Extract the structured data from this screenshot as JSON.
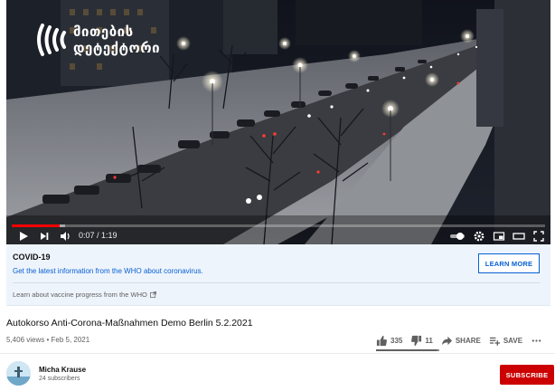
{
  "player": {
    "logo_line1": "მითების",
    "logo_line2": "დეტექტორი",
    "time_display": "0:07 / 1:19",
    "progress_fraction": 0.089,
    "buffer_fraction": 0.1
  },
  "covid": {
    "title": "COVID-19",
    "description": "Get the latest information from the WHO about coronavirus.",
    "vaccine_link": "Learn about vaccine progress from the WHO",
    "learn_more": "LEARN MORE"
  },
  "video": {
    "title": "Autokorso Anti-Corona-Maßnahmen Demo Berlin 5.2.2021",
    "views_date": "5,406 views • Feb 5, 2021",
    "likes": "335",
    "dislikes": "11",
    "share_label": "SHARE",
    "save_label": "SAVE",
    "like_fraction": 0.968
  },
  "channel": {
    "name": "Micha Krause",
    "subscribers": "24 subscribers",
    "subscribe_label": "SUBSCRIBE"
  },
  "colors": {
    "accent_red": "#cc0000",
    "link_blue": "#065fd4",
    "panel_bg": "#eef4fb"
  }
}
